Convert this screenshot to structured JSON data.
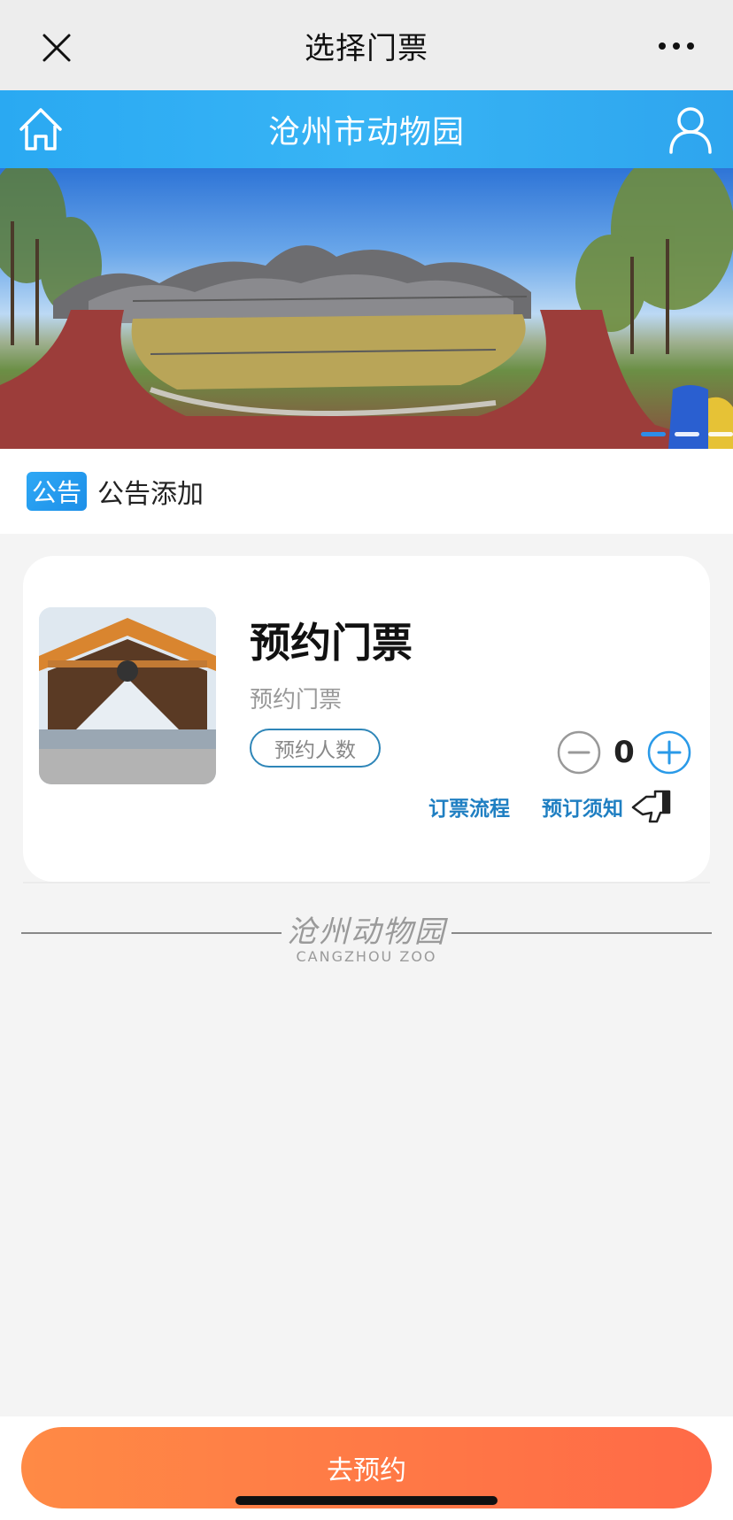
{
  "top_bar": {
    "title": "选择门票",
    "close_icon": "close-icon",
    "more_icon": "more-icon"
  },
  "header": {
    "title": "沧州市动物园",
    "home_icon": "home-icon",
    "user_icon": "user-icon",
    "color": "#2aa9f2"
  },
  "banner": {
    "slides": 3,
    "active_slide": 1
  },
  "notice": {
    "tag": "公告",
    "text": "公告添加"
  },
  "ticket": {
    "title": "预约门票",
    "subtitle": "预约门票",
    "badge": "预约人数",
    "quantity": "0",
    "link_process": "订票流程",
    "link_notice": "预订须知"
  },
  "logo": {
    "cn": "沧州动物园",
    "en": "CANGZHOU ZOO"
  },
  "bottom": {
    "book_button": "去预约",
    "accent": "#ff6a47"
  }
}
